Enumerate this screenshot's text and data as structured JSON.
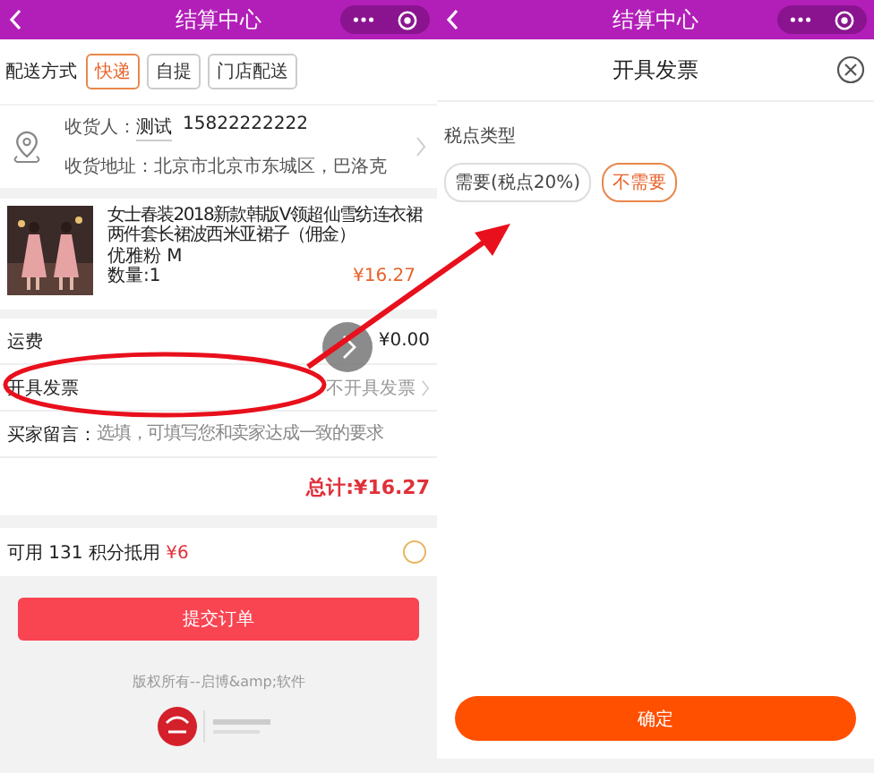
{
  "checkout": {
    "header": {
      "title": "结算中心"
    },
    "delivery": {
      "label": "配送方式",
      "options": [
        {
          "label": "快递",
          "selected": true
        },
        {
          "label": "自提",
          "selected": false
        },
        {
          "label": "门店配送",
          "selected": false
        }
      ]
    },
    "address": {
      "receiver_label": "收货人：",
      "receiver_name": "测试",
      "phone": "15822222222",
      "address_label": "收货地址：",
      "address": "北京市北京市东城区，巴洛克"
    },
    "product": {
      "title": "女士春装2018新款韩版V领超仙雪纺连衣裙两件套长裙波西米亚裙子（佣金）",
      "variant": "优雅粉 M",
      "quantity": "数量:1",
      "price": "¥16.27"
    },
    "shipping": {
      "label": "运费",
      "value": "¥0.00"
    },
    "invoice": {
      "label": "开具发票",
      "value": "不开具发票"
    },
    "message": {
      "label": "买家留言：",
      "placeholder": "选填，可填写您和卖家达成一致的要求"
    },
    "total": "总计:¥16.27",
    "points": {
      "text": "可用 131 积分抵用",
      "amount": "¥6",
      "checked": false
    },
    "submit": "提交订单",
    "copyright": "版权所有--启博&amp;软件"
  },
  "invoice_sheet": {
    "header": {
      "title": "结算中心"
    },
    "title": "开具发票",
    "tax_label": "税点类型",
    "options": [
      {
        "label": "需要(税点20%)",
        "selected": false
      },
      {
        "label": "不需要",
        "selected": true
      }
    ],
    "confirm": "确定"
  }
}
